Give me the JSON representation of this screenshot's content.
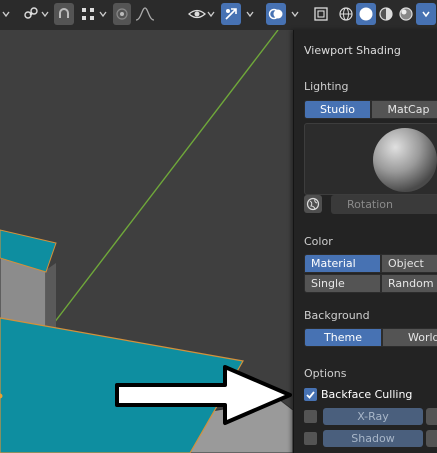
{
  "header": {
    "icons": [
      "transform-pivot-icon",
      "snap-icon",
      "proportional-edit-icon",
      "falloff-icon",
      "visibility-icon",
      "gizmo-icon",
      "overlay-icon",
      "xray-icon",
      "shading-wireframe-icon",
      "shading-solid-icon",
      "shading-material-icon",
      "shading-rendered-icon"
    ]
  },
  "panel": {
    "title": "Viewport Shading",
    "lighting": {
      "label": "Lighting",
      "options": [
        "Studio",
        "MatCap"
      ],
      "selected": "Studio",
      "rotation_label": "Rotation"
    },
    "color": {
      "label": "Color",
      "options": [
        "Material",
        "Object",
        "Single",
        "Random"
      ],
      "selected": "Material"
    },
    "background": {
      "label": "Background",
      "options": [
        "Theme",
        "World"
      ],
      "selected": "Theme"
    },
    "options": {
      "label": "Options",
      "backface_culling": {
        "label": "Backface Culling",
        "checked": true
      },
      "xray": {
        "label": "X-Ray",
        "checked": false
      },
      "shadow": {
        "label": "Shadow",
        "checked": false
      }
    }
  },
  "colors": {
    "accent": "#4772b3",
    "plane": "#0e8ea0",
    "plane_edge": "#d4913a",
    "axis_y": "#6fa83a",
    "axis_x": "#b33c3c"
  }
}
